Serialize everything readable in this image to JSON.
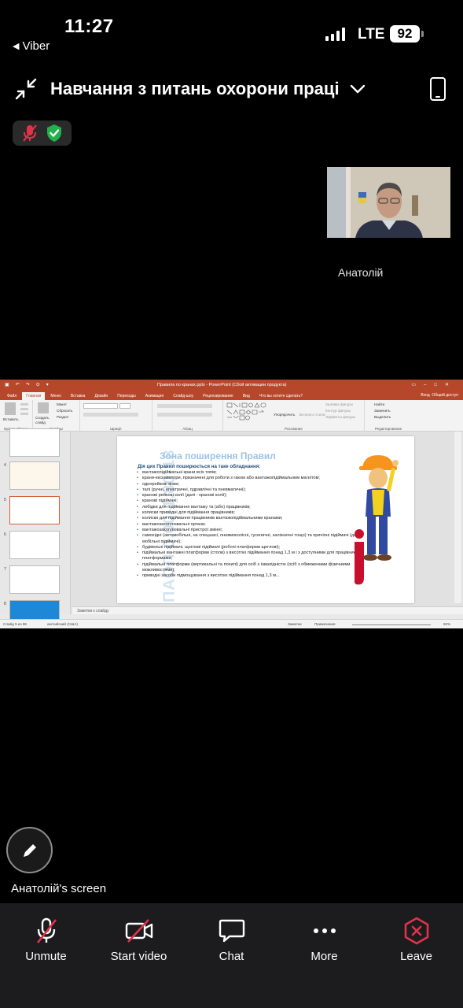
{
  "status_bar": {
    "time": "11:27",
    "back_app": "Viber",
    "network": "LTE",
    "battery": "92"
  },
  "meeting": {
    "title": "Навчання з питань охорони праці"
  },
  "participant": {
    "name": "Анатолій"
  },
  "shared_screen": {
    "window_title": "Правила по кранах.pptx - PowerPoint (Сбой активации продукта)",
    "tabs": [
      "Файл",
      "Главная",
      "Меню",
      "Вставка",
      "Дизайн",
      "Переходы",
      "Анимация",
      "Слайд-шоу",
      "Рецензирование",
      "Вид",
      "Что вы хотите сделать?"
    ],
    "account": "Вход",
    "share": "Общий доступ",
    "ribbon": {
      "groups": [
        "Буфер обмена",
        "Слайды",
        "Шрифт",
        "Абзац",
        "Рисование",
        "Редактирование"
      ],
      "paste": "Вставить",
      "new_slide": "Создать слайд",
      "layout": "Макет",
      "reset": "Сбросить",
      "section": "Раздел",
      "arrange": "Упорядочить",
      "quick_styles": "Экспресс-стили",
      "shape_fill": "Заливка фигуры",
      "shape_outline": "Контур фигуры",
      "shape_effects": "Эффекты фигуры",
      "find": "Найти",
      "replace": "Заменить",
      "select": "Выделить"
    },
    "thumbnails": [
      "4",
      "5",
      "6",
      "7",
      "8"
    ],
    "slide": {
      "title": "Зона поширення Правил",
      "subtitle": "Дія цих Правил поширюється на таке обладнання:",
      "watermark": "ППАОП 0.00-1.80-18",
      "bullets": [
        "вантажопідіймальні крани всіх типів;",
        "крани-екскаватори, призначені для роботи з гаком або вантажопідіймальним магнітом;",
        "однорейкові візки;",
        "талі (ручні, електричні, пдравлічні та пневматичні);",
        "кранові рейкові колії (далі - кранові колії);",
        "кранові підіймачі;",
        "лебідки для підіймання вантажу та (або) працівників;",
        "колиски приводні для підіймання працівників;",
        "колиски для підіймання працівників вантажопідіймальними кранами;",
        "вантажозахоплювальні органи;",
        "вантажозахоплювальні пристрої змінні;",
        "самохідні (автомобільні, на спецшасі, пневмоколісні, гусеничні, залізничні тощо) та причіпні підіймачі (далі - мобільні підіймачі);",
        "будівельні підіймачі, щоглові підіймачі (робочі платформи щоглові);",
        "підіймальні вантажні платформи (столи) з висотою підіймання понад 1,3 м і з доступними для працівників платформами;",
        "підіймальні платформи (вертикальні та похилі) для осіб з інвалідністю (осіб з обмеженими фізичними можливостями);",
        "приводні засоби підмощування з висотою підіймання понад 1,3 м..."
      ]
    },
    "notes_placeholder": "Заметки к слайду",
    "statusbar": {
      "slide_info": "Слайд 5 из 86",
      "language": "английский (США)",
      "notes": "Заметки",
      "comments": "Примечания",
      "zoom": "92%"
    }
  },
  "screen_label": "Анатолій's screen",
  "toolbar": {
    "unmute": "Unmute",
    "start_video": "Start video",
    "chat": "Chat",
    "more": "More",
    "leave": "Leave"
  },
  "colors": {
    "leave_red": "#e0334a",
    "muted_red": "#e0334a",
    "shield_green": "#22b14c",
    "powerpoint": "#b7472a"
  }
}
